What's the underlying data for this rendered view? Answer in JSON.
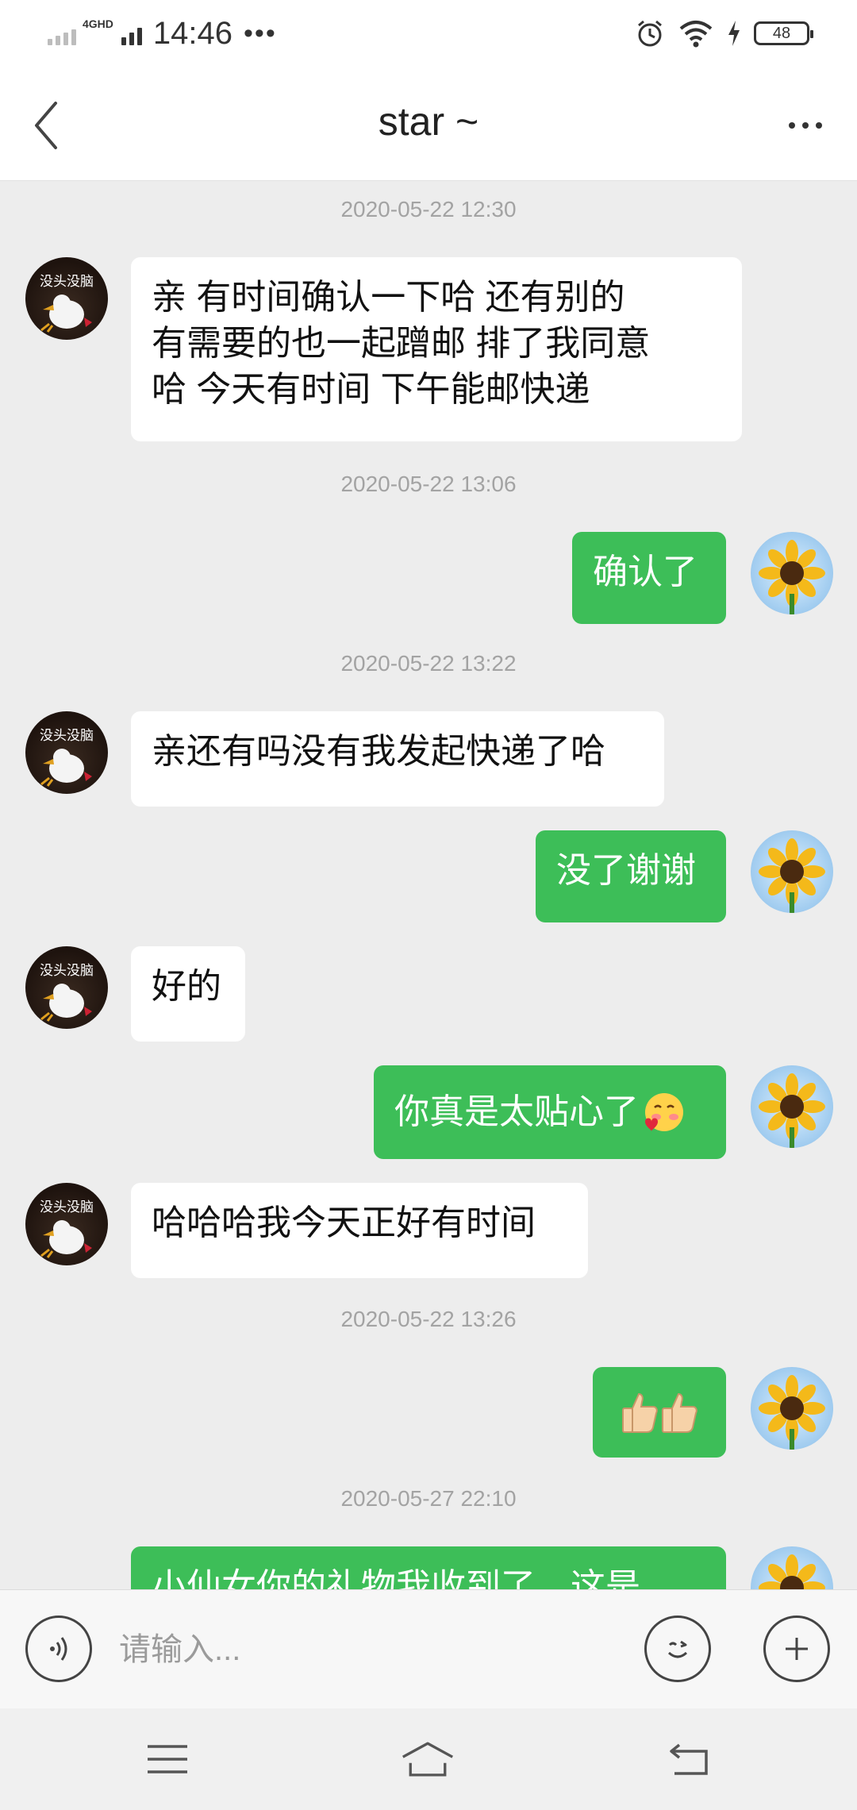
{
  "status_bar": {
    "network": "4GHD",
    "time": "14:46",
    "more": "•••",
    "battery": "48"
  },
  "header": {
    "title": "star ~"
  },
  "messages": [
    {
      "timestamp": "2020-05-22 12:30"
    },
    {
      "from": "other",
      "avatar_label": "没头没脑",
      "text": "亲  有时间确认一下哈  还有别的\n有需要的也一起蹭邮  排了我同意\n哈  今天有时间  下午能邮快递"
    },
    {
      "timestamp": "2020-05-22 13:06"
    },
    {
      "from": "me",
      "text": "确认了"
    },
    {
      "timestamp": "2020-05-22 13:22"
    },
    {
      "from": "other",
      "avatar_label": "没头没脑",
      "text": "亲还有吗没有我发起快递了哈"
    },
    {
      "from": "me",
      "text": "没了谢谢"
    },
    {
      "from": "other",
      "avatar_label": "没头没脑",
      "text": "好的"
    },
    {
      "from": "me",
      "text": "你真是太贴心了",
      "emoji": "blush-heart"
    },
    {
      "from": "other",
      "avatar_label": "没头没脑",
      "text": "哈哈哈我今天正好有时间"
    },
    {
      "timestamp": "2020-05-22 13:26"
    },
    {
      "from": "me",
      "emoji": "thumbs-up-x2",
      "text": "👍👍"
    },
    {
      "timestamp": "2020-05-27 22:10"
    },
    {
      "from": "me",
      "text": "小仙女你的礼物我收到了，这是"
    }
  ],
  "input_bar": {
    "placeholder": "请输入..."
  },
  "colors": {
    "out_bubble": "#3dbe58",
    "in_bubble": "#ffffff",
    "chat_bg": "#ededed"
  }
}
